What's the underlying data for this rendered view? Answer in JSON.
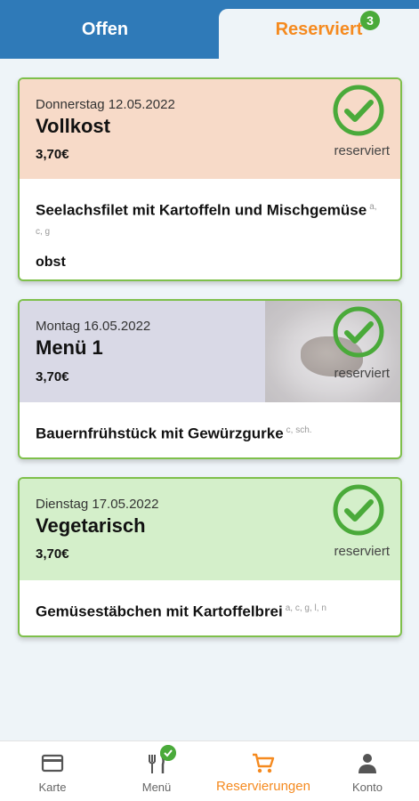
{
  "tabs": {
    "open_label": "Offen",
    "reserved_label": "Reserviert",
    "reserved_count": "3"
  },
  "reservations": [
    {
      "date": "Donnerstag 12.05.2022",
      "title": "Vollkost",
      "price": "3,70€",
      "status": "reserviert",
      "dish": "Seelachsfilet mit Kartoffeln und Mischgemüse",
      "allergens": "a, c, g",
      "extra": "obst",
      "header_color": "#f7dac8"
    },
    {
      "date": "Montag 16.05.2022",
      "title": "Menü 1",
      "price": "3,70€",
      "status": "reserviert",
      "dish": "Bauernfrühstück mit Gewürzgurke",
      "allergens": "c, sch.",
      "header_color": "#d9d9e6"
    },
    {
      "date": "Dienstag 17.05.2022",
      "title": "Vegetarisch",
      "price": "3,70€",
      "status": "reserviert",
      "dish": "Gemüsestäbchen mit Kartoffelbrei",
      "allergens": "a, c, g, l, n",
      "header_color": "#d4efca"
    }
  ],
  "nav": {
    "karte": "Karte",
    "menu": "Menü",
    "reservierungen": "Reservierungen",
    "konto": "Konto"
  },
  "colors": {
    "brand_blue": "#2f7ab8",
    "accent_orange": "#f58a1f",
    "check_green": "#4aaa3a",
    "card_border": "#7ec04b"
  },
  "icons": {
    "karte": "credit-card-icon",
    "menu": "fork-knife-icon",
    "reservierungen": "cart-icon",
    "konto": "person-icon",
    "status": "check-circle-icon"
  }
}
